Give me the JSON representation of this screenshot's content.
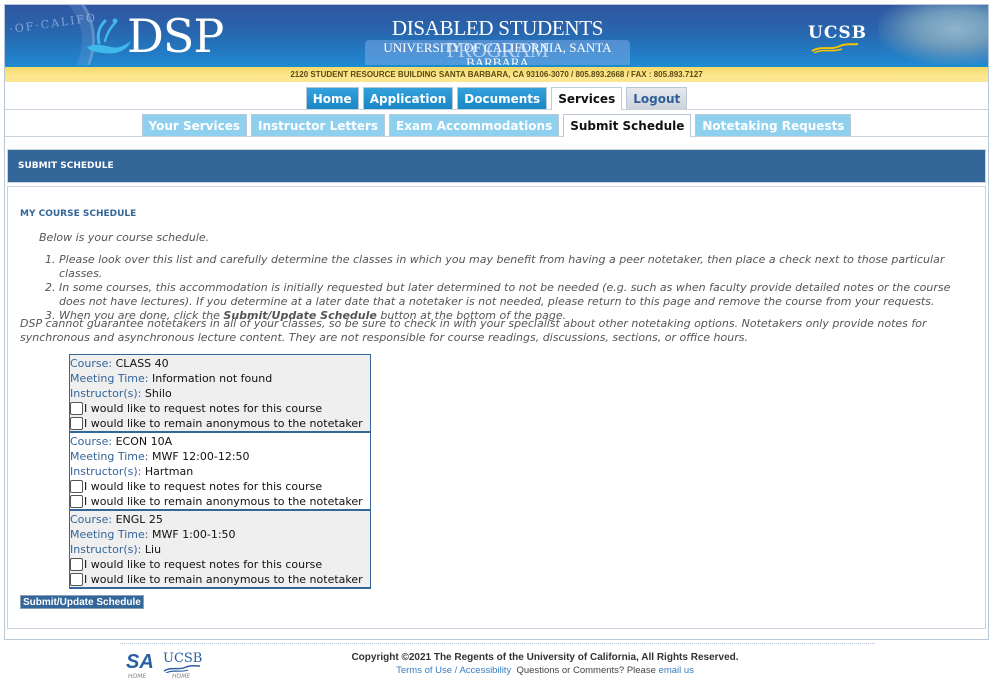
{
  "banner": {
    "seal_text": "·OF·CALIFO",
    "logo": "DSP",
    "program_title": "DISABLED STUDENTS PROGRAM",
    "program_subtitle": "UNIVERSITY OF CALIFORNIA, SANTA BARBARA",
    "ucsb_logo": "UCSB",
    "address": "2120 STUDENT RESOURCE BUILDING SANTA BARBARA, CA 93106-3070 / 805.893.2668 / FAX : 805.893.7127"
  },
  "main_tabs": [
    {
      "label": "Home"
    },
    {
      "label": "Application"
    },
    {
      "label": "Documents"
    },
    {
      "label": "Services",
      "active": true
    },
    {
      "label": "Logout"
    }
  ],
  "sub_tabs": [
    {
      "label": "Your Services"
    },
    {
      "label": "Instructor Letters"
    },
    {
      "label": "Exam Accommodations"
    },
    {
      "label": "Submit Schedule",
      "active": true
    },
    {
      "label": "Notetaking Requests"
    }
  ],
  "section": {
    "header": "SUBMIT SCHEDULE",
    "title": "MY COURSE SCHEDULE",
    "intro": "Below is your course schedule.",
    "steps": [
      "Please look over this list and carefully determine the classes in which you may benefit from having a peer notetaker, then place a check next to those particular classes.",
      "In some courses, this accommodation is initially requested but later determined to not be needed (e.g. such as when faculty provide detailed notes or the course does not have lectures). If you determine at a later date that a notetaker is not needed, please return to this page and remove the course from your requests.",
      {
        "before": "When you are done, click the ",
        "bold": "Submit/Update Schedule",
        "after": " button at the bottom of the page."
      }
    ],
    "disclaimer": "DSP cannot guarantee notetakers in all of your classes, so be sure to check in with your specialist about other notetaking options. Notetakers only provide notes for synchronous and asynchronous lecture content. They are not responsible for course readings, discussions, sections, or office hours."
  },
  "labels": {
    "course": "Course:",
    "meeting_time": "Meeting Time:",
    "instructors": "Instructor(s):",
    "request_notes": "I would like to request notes for this course",
    "anonymous": "I would like to remain anonymous to the notetaker"
  },
  "courses": [
    {
      "course": "CLASS 40",
      "meeting_time": "Information not found",
      "instructors": "Shilo",
      "request_notes": false,
      "anonymous": false
    },
    {
      "course": "ECON 10A",
      "meeting_time": "MWF 12:00-12:50",
      "instructors": "Hartman",
      "request_notes": false,
      "anonymous": false
    },
    {
      "course": "ENGL 25",
      "meeting_time": "MWF 1:00-1:50",
      "instructors": "Liu",
      "request_notes": false,
      "anonymous": false
    }
  ],
  "submit_label": "Submit/Update Schedule",
  "footer": {
    "sa_logo": "SA",
    "sa_home": "HOME",
    "ucsb_logo": "UCSB",
    "ucsb_home": "HOME",
    "copyright": "Copyright ©2021 The Regents of the University of California, All Rights Reserved.",
    "terms": "Terms of Use",
    "separator": " / ",
    "accessibility": "Accessibility",
    "questions": "  Questions or Comments? Please ",
    "email": "email us"
  },
  "colors": {
    "brand_blue": "#336699",
    "tab_blue": "#1a86c6",
    "subtab_blue": "#8fd0ee",
    "address_yellow": "#fce78f"
  }
}
